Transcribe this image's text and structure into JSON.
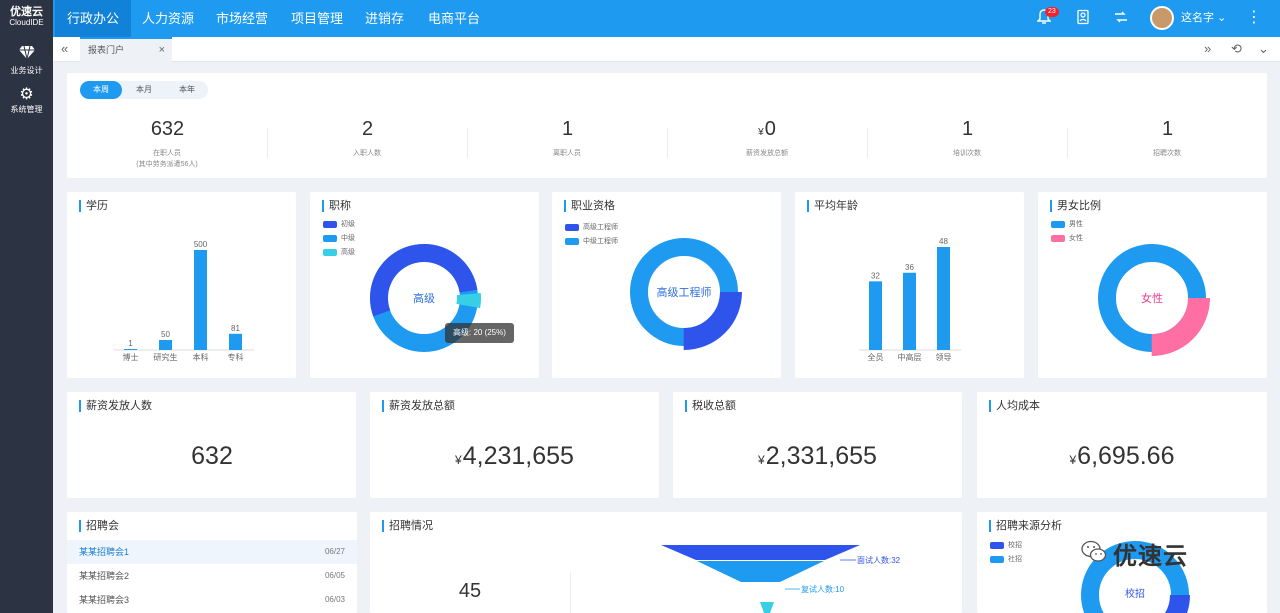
{
  "brand": {
    "name": "优速云",
    "sub": "CloudIDE"
  },
  "sidebar": [
    {
      "icon": "gem-icon",
      "label": "业务设计"
    },
    {
      "icon": "gear-icon",
      "label": "系统管理"
    }
  ],
  "topnav": [
    "行政办公",
    "人力资源",
    "市场经营",
    "项目管理",
    "进销存",
    "电商平台"
  ],
  "topnav_active": 0,
  "user": {
    "name": "这名字",
    "notifications": "23"
  },
  "tab": {
    "label": "报表门户"
  },
  "period": {
    "options": [
      "本周",
      "本月",
      "本年"
    ],
    "selected": 0
  },
  "stats": [
    {
      "value": "632",
      "prefix": "",
      "label": "在职人员",
      "note": "(其中劳务派遣56人)"
    },
    {
      "value": "2",
      "prefix": "",
      "label": "入职人数",
      "note": ""
    },
    {
      "value": "1",
      "prefix": "",
      "label": "离职人员",
      "note": ""
    },
    {
      "value": "0",
      "prefix": "¥",
      "label": "薪资发放总额",
      "note": ""
    },
    {
      "value": "1",
      "prefix": "",
      "label": "培训次数",
      "note": ""
    },
    {
      "value": "1",
      "prefix": "",
      "label": "招聘次数",
      "note": ""
    }
  ],
  "education": {
    "title": "学历",
    "categories": [
      "博士",
      "研究生",
      "本科",
      "专科"
    ],
    "values": [
      1,
      50,
      500,
      81
    ]
  },
  "titles": {
    "title": "职称",
    "legend": [
      "初级",
      "中级",
      "高级"
    ],
    "center": "高级",
    "tooltip": "高级: 20 (25%)"
  },
  "qualification": {
    "title": "职业资格",
    "legend": [
      "高级工程师",
      "中级工程师"
    ],
    "center": "高级工程师"
  },
  "age": {
    "title": "平均年龄",
    "categories": [
      "全员",
      "中高层",
      "领导"
    ],
    "values": [
      32,
      36,
      48
    ]
  },
  "gender": {
    "title": "男女比例",
    "legend": [
      "男性",
      "女性"
    ],
    "center": "女性"
  },
  "metrics": [
    {
      "title": "薪资发放人数",
      "prefix": "",
      "value": "632"
    },
    {
      "title": "薪资发放总额",
      "prefix": "¥",
      "value": "4,231,655"
    },
    {
      "title": "税收总额",
      "prefix": "¥",
      "value": "2,331,655"
    },
    {
      "title": "人均成本",
      "prefix": "¥",
      "value": "6,695.66"
    }
  ],
  "jobfair": {
    "title": "招聘会",
    "items": [
      {
        "name": "某某招聘会1",
        "date": "06/27"
      },
      {
        "name": "某某招聘会2",
        "date": "06/05"
      },
      {
        "name": "某某招聘会3",
        "date": "06/03"
      }
    ]
  },
  "recruit": {
    "title": "招聘情况",
    "count": "45",
    "funnel": [
      "面试人数:32",
      "复试人数:10"
    ]
  },
  "source": {
    "title": "招聘来源分析",
    "legend": [
      "校招",
      "社招"
    ],
    "center": "校招"
  },
  "watermark": {
    "text": "优速云"
  },
  "colors": {
    "primary": "#1e9bf0",
    "dark": "#2f54eb",
    "cyan": "#36cfe6",
    "pink": "#ff6fa3"
  },
  "chart_data": [
    {
      "type": "bar",
      "title": "学历",
      "categories": [
        "博士",
        "研究生",
        "本科",
        "专科"
      ],
      "values": [
        1,
        50,
        500,
        81
      ]
    },
    {
      "type": "pie",
      "title": "职称",
      "labels": [
        "初级",
        "中级",
        "高级"
      ],
      "values": [
        null,
        null,
        20
      ]
    },
    {
      "type": "bar",
      "title": "平均年龄",
      "categories": [
        "全员",
        "中高层",
        "领导"
      ],
      "values": [
        32,
        36,
        48
      ]
    }
  ]
}
